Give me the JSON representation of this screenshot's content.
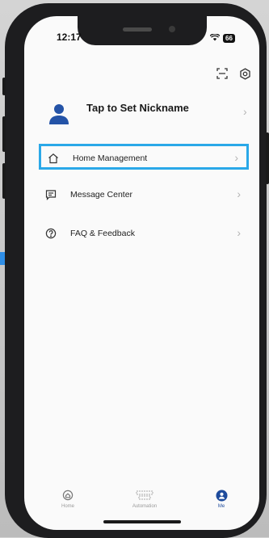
{
  "status_bar": {
    "time": "12:17",
    "battery": "66"
  },
  "profile": {
    "nickname": "Tap to Set Nickname"
  },
  "menu": {
    "items": [
      {
        "label": "Home Management",
        "icon": "house-icon",
        "highlighted": true
      },
      {
        "label": "Message Center",
        "icon": "message-icon",
        "highlighted": false
      },
      {
        "label": "FAQ & Feedback",
        "icon": "question-circle-icon",
        "highlighted": false
      }
    ]
  },
  "bottom_nav": {
    "items": [
      {
        "label": "Home",
        "icon": "home-icon",
        "active": false
      },
      {
        "label": "Automation",
        "icon": "automation-icon",
        "active": false
      },
      {
        "label": "Me",
        "icon": "person-icon",
        "active": true
      }
    ]
  },
  "colors": {
    "accent": "#1e4b9c",
    "highlight_border": "#2aa8e8",
    "side_accent": "#2f8ee6"
  }
}
